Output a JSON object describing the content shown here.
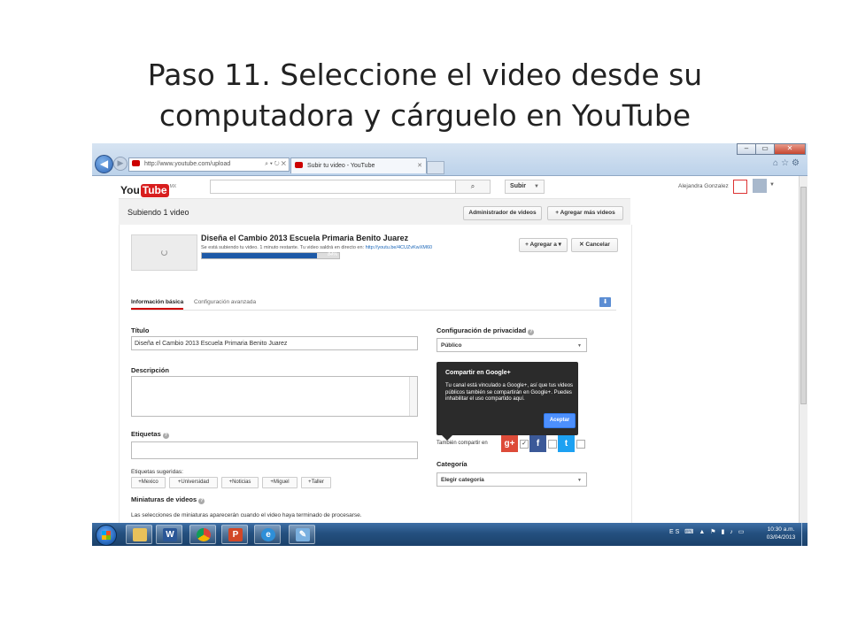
{
  "slide": {
    "title_line1": "Paso 11. Seleccione el video desde su",
    "title_line2": "computadora y cárguelo en YouTube"
  },
  "browser": {
    "address": "http://www.youtube.com/upload",
    "address_controls": "⌕ ▾ ↻ ✕",
    "tab_title": "Subir tu video - YouTube",
    "tab_close": "✕",
    "window_controls": [
      "–",
      "▭",
      "✕"
    ],
    "icons": [
      "home-icon",
      "star-icon",
      "gear-icon"
    ]
  },
  "youtube": {
    "logo_you": "You",
    "logo_tube": "Tube",
    "logo_country": "MX",
    "search_placeholder": "",
    "upload_label": "Subir",
    "user_name": "Alejandra Gonzalez"
  },
  "upload": {
    "heading": "Subiendo 1 video",
    "manager_button": "Administrador de videos",
    "add_more_button": "+ Agregar más videos",
    "video_title": "Diseña el Cambio 2013 Escuela Primaria Benito Juarez",
    "status_text": "Se está subiendo tu video. 1 minuto restante. Tu video saldrá en directo en: ",
    "video_url": "http://youtu.be/4CUZvKwXM60",
    "progress_percent": 84,
    "progress_label": "84%",
    "add_to_button": "+ Agregar a ▾",
    "cancel_button": "✕ Cancelar"
  },
  "tabs": {
    "basic": "Información básica",
    "advanced": "Configuración avanzada"
  },
  "form": {
    "title_label": "Título",
    "title_value": "Diseña el Cambio 2013 Escuela Primaria Benito Juarez",
    "description_label": "Descripción",
    "description_value": "",
    "tags_label": "Etiquetas",
    "tags_value": "",
    "suggested_label": "Etiquetas sugeridas:",
    "suggested_tags": [
      "+Mexico",
      "+Universidad",
      "+Noticias",
      "+Miguel",
      "+Taller"
    ],
    "thumbnails_label": "Miniaturas de videos",
    "thumbnails_note": "Las selecciones de miniaturas aparecerán cuando el video haya terminado de procesarse."
  },
  "privacy": {
    "label": "Configuración de privacidad",
    "selected": "Público",
    "popup_title": "Compartir en Google+",
    "popup_body": "Tu canal está vinculado a Google+, así que tus videos públicos también se compartirán en Google+. Puedes inhabilitar el uso compartido aquí.",
    "popup_accept": "Aceptar",
    "share_label": "También compartir en",
    "share_networks": [
      "google-plus",
      "facebook",
      "twitter"
    ],
    "google_plus_checked": true,
    "category_label": "Categoría",
    "category_selected": "Elegir categoría"
  },
  "taskbar": {
    "apps": [
      "file-explorer",
      "word",
      "chrome",
      "powerpoint",
      "internet-explorer",
      "paint"
    ],
    "language": "ES",
    "time": "10:30 a.m.",
    "date": "03/04/2013"
  },
  "colors": {
    "youtube_red": "#d81e1e",
    "progress_blue": "#1e5aa7",
    "link_blue": "#1a66b8",
    "popup_bg": "#2b2b2b",
    "accept_blue": "#4d90fe",
    "google_plus": "#dd4b39",
    "facebook": "#3b5998",
    "twitter": "#1da1f2"
  }
}
